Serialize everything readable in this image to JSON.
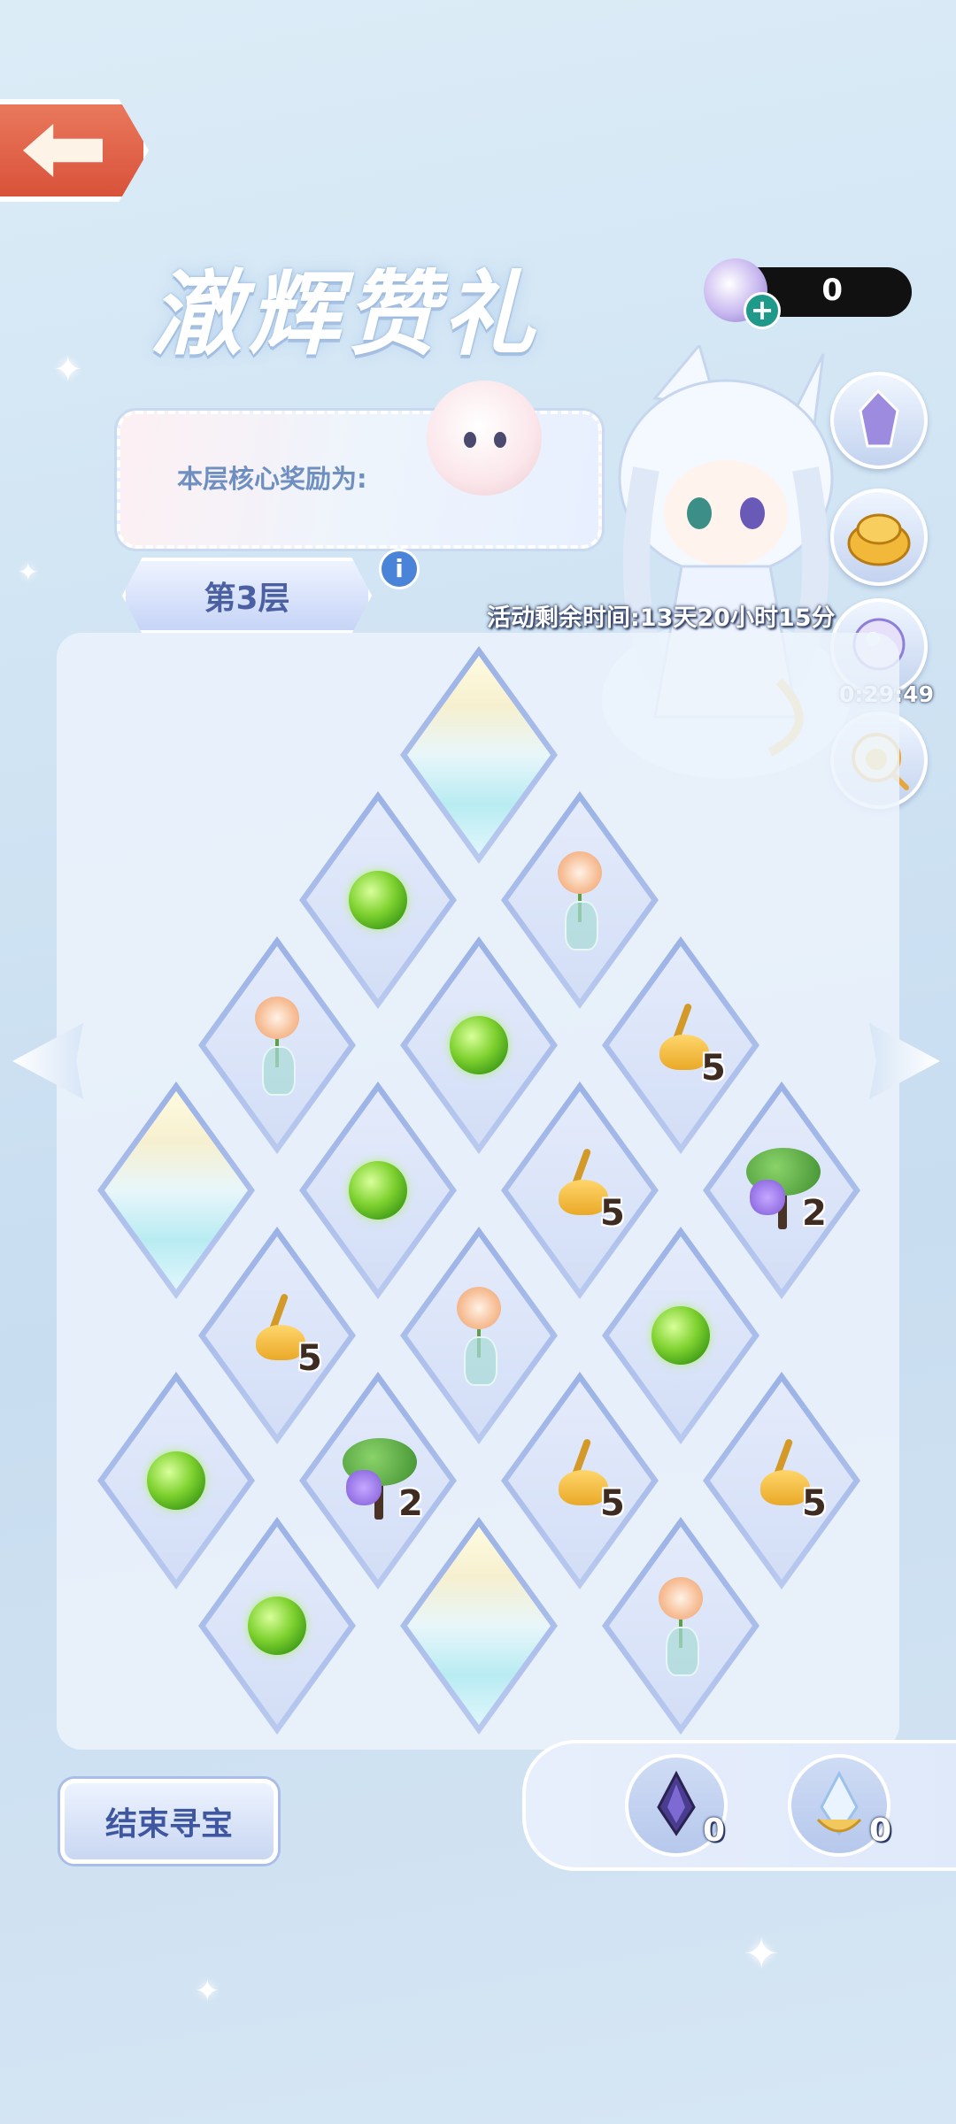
{
  "header": {
    "title": "澈辉赞礼",
    "currency_value": "0"
  },
  "reward": {
    "label": "本层核心奖励为:"
  },
  "floor": {
    "label": "第3层"
  },
  "event": {
    "remaining_time": "活动剩余时间:13天20小时15分"
  },
  "side_menu": {
    "timer": "0:29:49",
    "buttons": [
      "crystal-icon",
      "gold-treasure-icon",
      "pet-egg-icon",
      "duck-search-icon"
    ]
  },
  "board": {
    "tiles": [
      {
        "item": "crystal"
      },
      {
        "item": "orb"
      },
      {
        "item": "vase"
      },
      {
        "item": "vase"
      },
      {
        "item": "orb"
      },
      {
        "item": "broom",
        "count": "5"
      },
      {
        "item": "crystal"
      },
      {
        "item": "orb"
      },
      {
        "item": "broom",
        "count": "5"
      },
      {
        "item": "tree",
        "count": "2"
      },
      {
        "item": "broom",
        "count": "5"
      },
      {
        "item": "vase"
      },
      {
        "item": "orb"
      },
      {
        "item": "orb"
      },
      {
        "item": "tree",
        "count": "2"
      },
      {
        "item": "broom",
        "count": "5"
      },
      {
        "item": "broom",
        "count": "5"
      },
      {
        "item": "orb"
      },
      {
        "item": "crystal"
      },
      {
        "item": "vase"
      }
    ]
  },
  "footer": {
    "end_button": "结束寻宝",
    "inventory": [
      {
        "icon": "dark-crystal-icon",
        "count": "0"
      },
      {
        "icon": "light-crystal-icon",
        "count": "0"
      }
    ]
  }
}
